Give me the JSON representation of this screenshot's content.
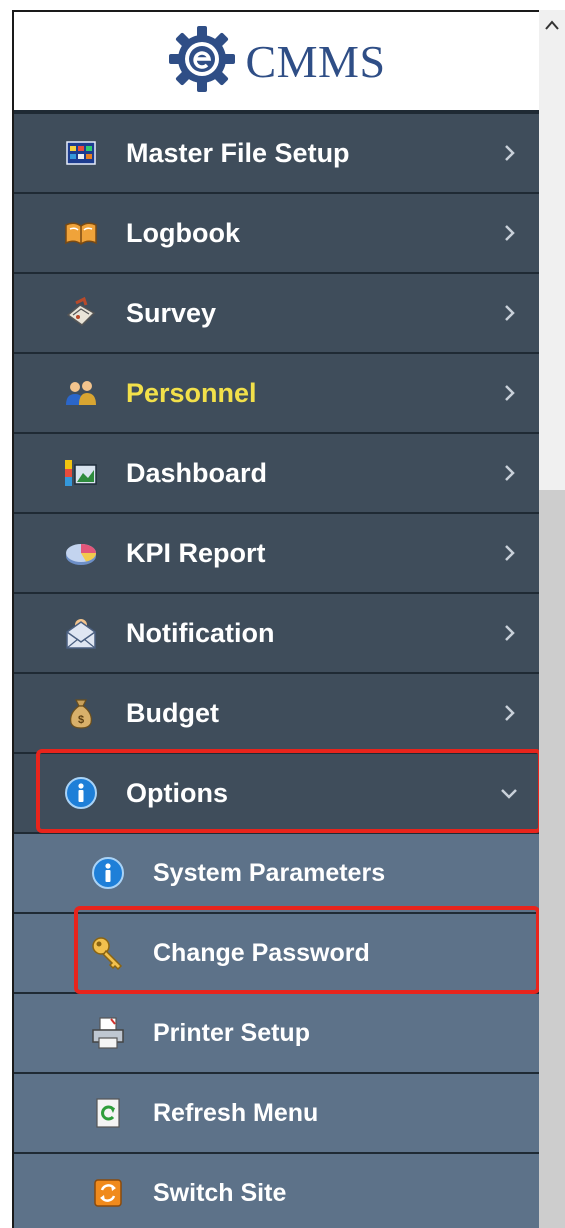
{
  "logo": {
    "text": "CMMS",
    "icon": "e-gear-logo-icon"
  },
  "menu": [
    {
      "label": "Master File Setup",
      "icon": "grid-table-icon",
      "expanded": false
    },
    {
      "label": "Logbook",
      "icon": "open-book-icon",
      "expanded": false
    },
    {
      "label": "Survey",
      "icon": "survey-clipboard-icon",
      "expanded": false
    },
    {
      "label": "Personnel",
      "icon": "people-icon",
      "expanded": false,
      "color": "#f2e04a"
    },
    {
      "label": "Dashboard",
      "icon": "dashboard-chart-icon",
      "expanded": false
    },
    {
      "label": "KPI Report",
      "icon": "pie-chart-icon",
      "expanded": false
    },
    {
      "label": "Notification",
      "icon": "envelope-icon",
      "expanded": false
    },
    {
      "label": "Budget",
      "icon": "money-bag-icon",
      "expanded": false
    },
    {
      "label": "Options",
      "icon": "info-icon",
      "expanded": true
    }
  ],
  "submenu": [
    {
      "label": "System Parameters",
      "icon": "info-icon"
    },
    {
      "label": "Change Password",
      "icon": "key-icon"
    },
    {
      "label": "Printer Setup",
      "icon": "printer-icon"
    },
    {
      "label": "Refresh Menu",
      "icon": "refresh-icon"
    },
    {
      "label": "Switch Site",
      "icon": "switch-site-icon"
    }
  ],
  "colors": {
    "menu_bg": "#3f4d5b",
    "submenu_bg": "#5d7289",
    "highlight": "#e8241c",
    "accent_text": "#f2e04a",
    "logo_text": "#2f4e86"
  }
}
